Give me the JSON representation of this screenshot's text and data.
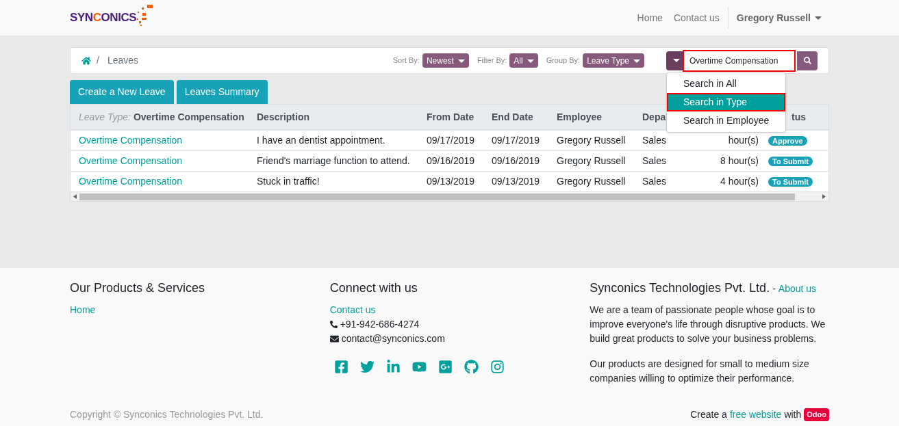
{
  "navbar": {
    "logo": "SYNCONICS",
    "links": [
      "Home",
      "Contact us"
    ],
    "user": "Gregory Russell"
  },
  "breadcrumb": {
    "separator": "/",
    "current": "Leaves"
  },
  "controls": [
    {
      "label": "Sort By:",
      "value": "Newest"
    },
    {
      "label": "Filter By:",
      "value": "All"
    },
    {
      "label": "Group By:",
      "value": "Leave Type"
    }
  ],
  "search": {
    "value": "Overtime Compensation",
    "highlighted": true,
    "menu": [
      {
        "label": "Search in All",
        "selected": false
      },
      {
        "label": "Search in Type",
        "selected": true
      },
      {
        "label": "Search in Employee",
        "selected": false
      }
    ]
  },
  "buttons": [
    "Create a New Leave",
    "Leaves Summary"
  ],
  "table": {
    "group_label": "Leave Type:",
    "group_value": "Overtime Compensation",
    "columns": [
      "Description",
      "From Date",
      "End Date",
      "Employee",
      "Depa",
      "tus"
    ],
    "rows": [
      {
        "type": "Overtime Compensation",
        "description": "I have an dentist appointment.",
        "from": "09/17/2019",
        "end": "09/17/2019",
        "employee": "Gregory Russell",
        "department": "Sales",
        "duration": "hour(s)",
        "status": "Approve"
      },
      {
        "type": "Overtime Compensation",
        "description": "Friend's marriage function to attend.",
        "from": "09/16/2019",
        "end": "09/16/2019",
        "employee": "Gregory Russell",
        "department": "Sales",
        "duration": "8 hour(s)",
        "status": "To Submit"
      },
      {
        "type": "Overtime Compensation",
        "description": "Stuck in traffic!",
        "from": "09/13/2019",
        "end": "09/13/2019",
        "employee": "Gregory Russell",
        "department": "Sales",
        "duration": "4 hour(s)",
        "status": "To Submit"
      }
    ]
  },
  "footer": {
    "products": {
      "title": "Our Products & Services",
      "links": [
        "Home"
      ]
    },
    "connect": {
      "title": "Connect with us",
      "link": "Contact us",
      "phone": "+91-942-686-4274",
      "email": "contact@synconics.com"
    },
    "about": {
      "title": "Synconics Technologies Pvt. Ltd.",
      "separator": "-",
      "link": "About us",
      "paragraphs": [
        "We are a team of passionate people whose goal is to improve everyone's life through disruptive products. We build great products to solve your business problems.",
        "Our products are designed for small to medium size companies willing to optimize their performance."
      ]
    },
    "copyright": "Copyright © Synconics Technologies Pvt. Ltd.",
    "credit": {
      "before": "Create a",
      "link": "free website",
      "after": "with",
      "badge": "Odoo"
    }
  }
}
